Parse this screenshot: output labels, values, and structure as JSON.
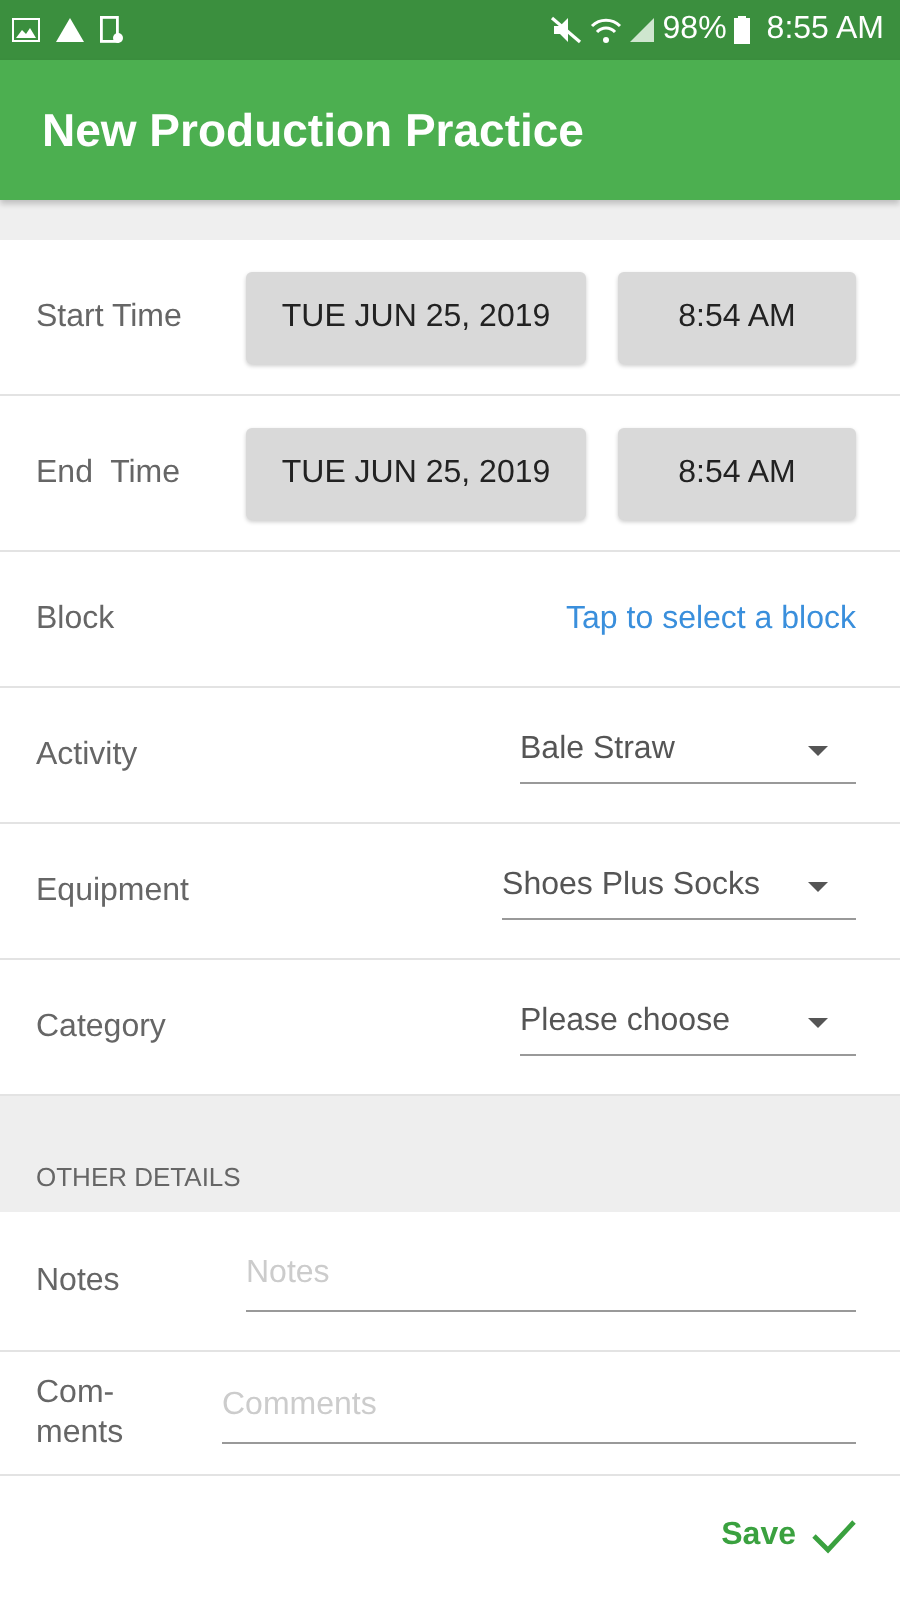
{
  "status_bar": {
    "battery": "98%",
    "time": "8:55 AM"
  },
  "app_bar": {
    "title": "New Production Practice"
  },
  "fields": [
    {
      "kind": "datetime",
      "label": "Start Time",
      "date": "TUE JUN 25, 2019",
      "time": "8:54 AM"
    },
    {
      "kind": "datetime",
      "label": "End  Time",
      "date": "TUE JUN 25, 2019",
      "time": "8:54 AM"
    },
    {
      "kind": "link",
      "label": "Block",
      "value": "Tap to select a block"
    },
    {
      "kind": "dropdown",
      "label": "Activity",
      "value": "Bale Straw"
    },
    {
      "kind": "dropdown",
      "label": "Equipment",
      "value": "Shoes Plus Socks"
    },
    {
      "kind": "dropdown",
      "label": "Category",
      "value": "Please choose"
    }
  ],
  "other_details": {
    "heading": "OTHER DETAILS",
    "fields": [
      {
        "label": "Notes",
        "placeholder": "Notes"
      },
      {
        "label": "Com-ments",
        "placeholder": "Comments"
      }
    ]
  },
  "footer": {
    "save_label": "Save"
  }
}
